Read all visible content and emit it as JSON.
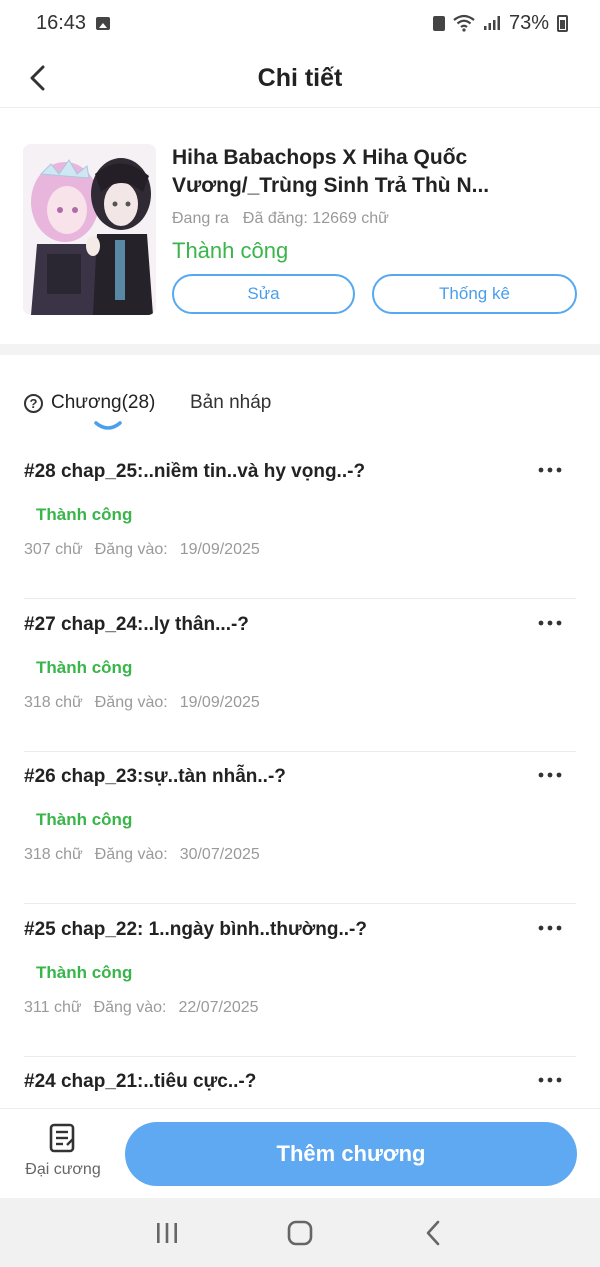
{
  "status_bar": {
    "time": "16:43",
    "battery": "73%",
    "icons": [
      "image-icon",
      "lock-icon",
      "wifi-icon",
      "signal-icon",
      "battery-icon"
    ]
  },
  "header": {
    "title": "Chi tiết",
    "back_icon": "chevron-left-icon"
  },
  "story": {
    "title": "Hiha Babachops X Hiha Quốc Vương/_Trùng Sinh Trả Thù N...",
    "state": "Đang ra",
    "word_count": "Đã đăng: 12669 chữ",
    "status": "Thành công",
    "edit_label": "Sửa",
    "stats_label": "Thống kê"
  },
  "tabs": {
    "chapters_label": "Chương(28)",
    "drafts_label": "Bản nháp"
  },
  "chapters": [
    {
      "title": "#28  chap_25:..niềm tin..và hy vọng..-?",
      "status": "Thành công",
      "words": "307 chữ",
      "posted_label": "Đăng vào:",
      "date": "19/09/2025"
    },
    {
      "title": "#27  chap_24:..ly thân...-?",
      "status": "Thành công",
      "words": "318 chữ",
      "posted_label": "Đăng vào:",
      "date": "19/09/2025"
    },
    {
      "title": "#26  chap_23:sự..tàn nhẫn..-?",
      "status": "Thành công",
      "words": "318 chữ",
      "posted_label": "Đăng vào:",
      "date": "30/07/2025"
    },
    {
      "title": "#25  chap_22: 1..ngày bình..thường..-?",
      "status": "Thành công",
      "words": "311 chữ",
      "posted_label": "Đăng vào:",
      "date": "22/07/2025"
    },
    {
      "title": "#24  chap_21:..tiêu cực..-?",
      "status": "",
      "words": "",
      "posted_label": "",
      "date": ""
    }
  ],
  "bottom_bar": {
    "outline_label": "Đại cương",
    "add_chapter_label": "Thêm chương"
  },
  "colors": {
    "accent": "#5ea9f1",
    "success": "#39b54a",
    "muted": "#9a9a9a"
  }
}
